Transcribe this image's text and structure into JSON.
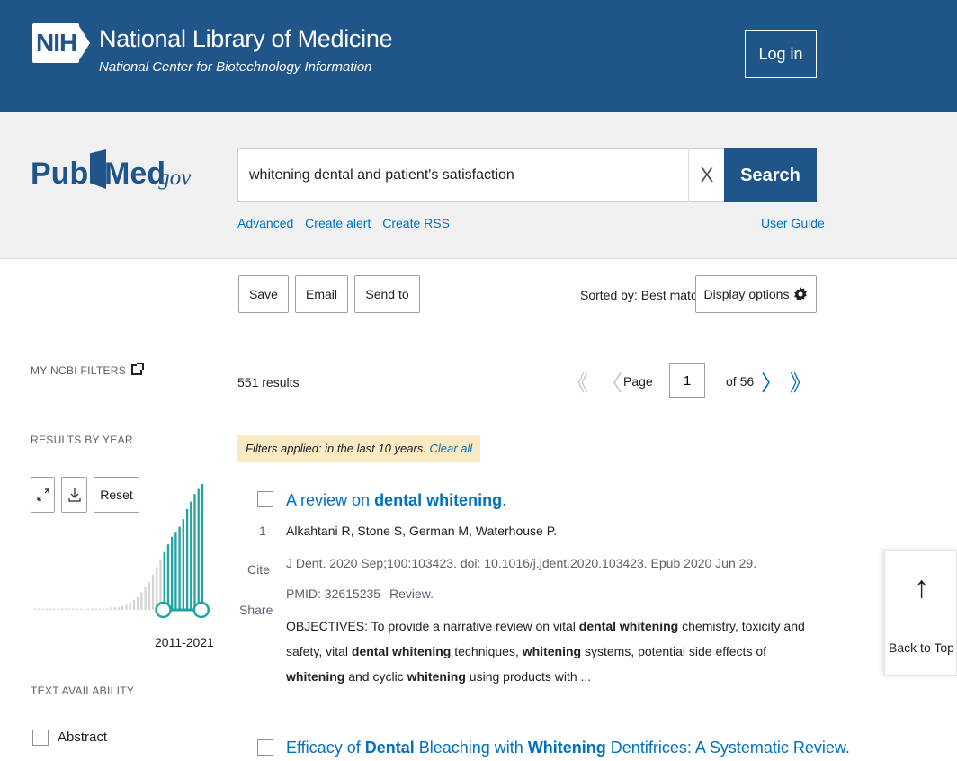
{
  "header": {
    "nih_logo_text": "NIH",
    "title": "National Library of Medicine",
    "subtitle": "National Center for Biotechnology Information",
    "login_label": "Log in"
  },
  "pubmed_logo": {
    "pub": "Pub",
    "med": "Med",
    "gov": ".gov"
  },
  "search": {
    "query": "whitening dental and patient's satisfaction",
    "clear_symbol": "X",
    "button_label": "Search",
    "links": [
      "Advanced",
      "Create alert",
      "Create RSS"
    ],
    "user_guide": "User Guide"
  },
  "toolbar": {
    "save_label": "Save",
    "email_label": "Email",
    "send_to_label": "Send to",
    "sorted_by": "Sorted by: Best match",
    "display_options": "Display options"
  },
  "sidebar": {
    "my_ncbi_filters": "MY NCBI FILTERS",
    "results_by_year": "RESULTS BY YEAR",
    "reset_label": "Reset",
    "year_range": "2011-2021",
    "text_availability": "TEXT AVAILABILITY",
    "abstract_label": "Abstract",
    "year_bars": [
      1,
      1,
      1,
      1,
      1,
      1,
      1,
      1,
      1,
      1,
      1,
      1,
      1,
      1,
      1,
      1,
      1,
      1,
      1,
      1,
      2,
      2,
      2,
      3,
      4,
      6,
      8,
      10,
      14,
      18,
      22,
      28,
      34,
      40,
      46,
      52,
      58,
      62,
      66,
      72,
      80,
      86,
      92,
      96,
      100
    ]
  },
  "results": {
    "count": "551 results",
    "page_label": "Page",
    "page_value": "1",
    "page_of": "of 56",
    "filters_text": "Filters applied: in the last 10 years.",
    "clear_all": "Clear all"
  },
  "articles": [
    {
      "number": "1",
      "title_pre": "A review on ",
      "title_bold": "dental whitening",
      "title_post": ".",
      "authors": "Alkahtani R, Stone S, German M, Waterhouse P.",
      "citation": "J Dent. 2020 Sep;100:103423. doi: 10.1016/j.jdent.2020.103423. Epub 2020 Jun 29.",
      "pmid": "PMID: 32615235",
      "type": "Review.",
      "cite_label": "Cite",
      "share_label": "Share",
      "snippet": [
        {
          "t": "OBJECTIVES: To provide a narrative review on vital ",
          "b": false
        },
        {
          "t": "dental whitening",
          "b": true
        },
        {
          "t": " chemistry, toxicity and safety, vital ",
          "b": false
        },
        {
          "t": "dental whitening",
          "b": true
        },
        {
          "t": " techniques, ",
          "b": false
        },
        {
          "t": "whitening",
          "b": true
        },
        {
          "t": " systems, potential side effects of ",
          "b": false
        },
        {
          "t": "whitening",
          "b": true
        },
        {
          "t": " and cyclic ",
          "b": false
        },
        {
          "t": "whitening",
          "b": true
        },
        {
          "t": " using products with ...",
          "b": false
        }
      ]
    },
    {
      "title_parts": [
        {
          "t": "Efficacy of ",
          "b": false
        },
        {
          "t": "Dental",
          "b": true
        },
        {
          "t": " Bleaching with ",
          "b": false
        },
        {
          "t": "Whitening",
          "b": true
        },
        {
          "t": " Dentifrices: A Systematic Review.",
          "b": false
        }
      ]
    }
  ],
  "back_to_top": {
    "arrow": "↑",
    "label": "Back to Top"
  },
  "colors": {
    "header_bg": "#20558a",
    "link": "#0071bc",
    "filters_bg": "#faeac4",
    "chart_bar": "#d4d4d4",
    "chart_selected": "#20a3a3"
  }
}
